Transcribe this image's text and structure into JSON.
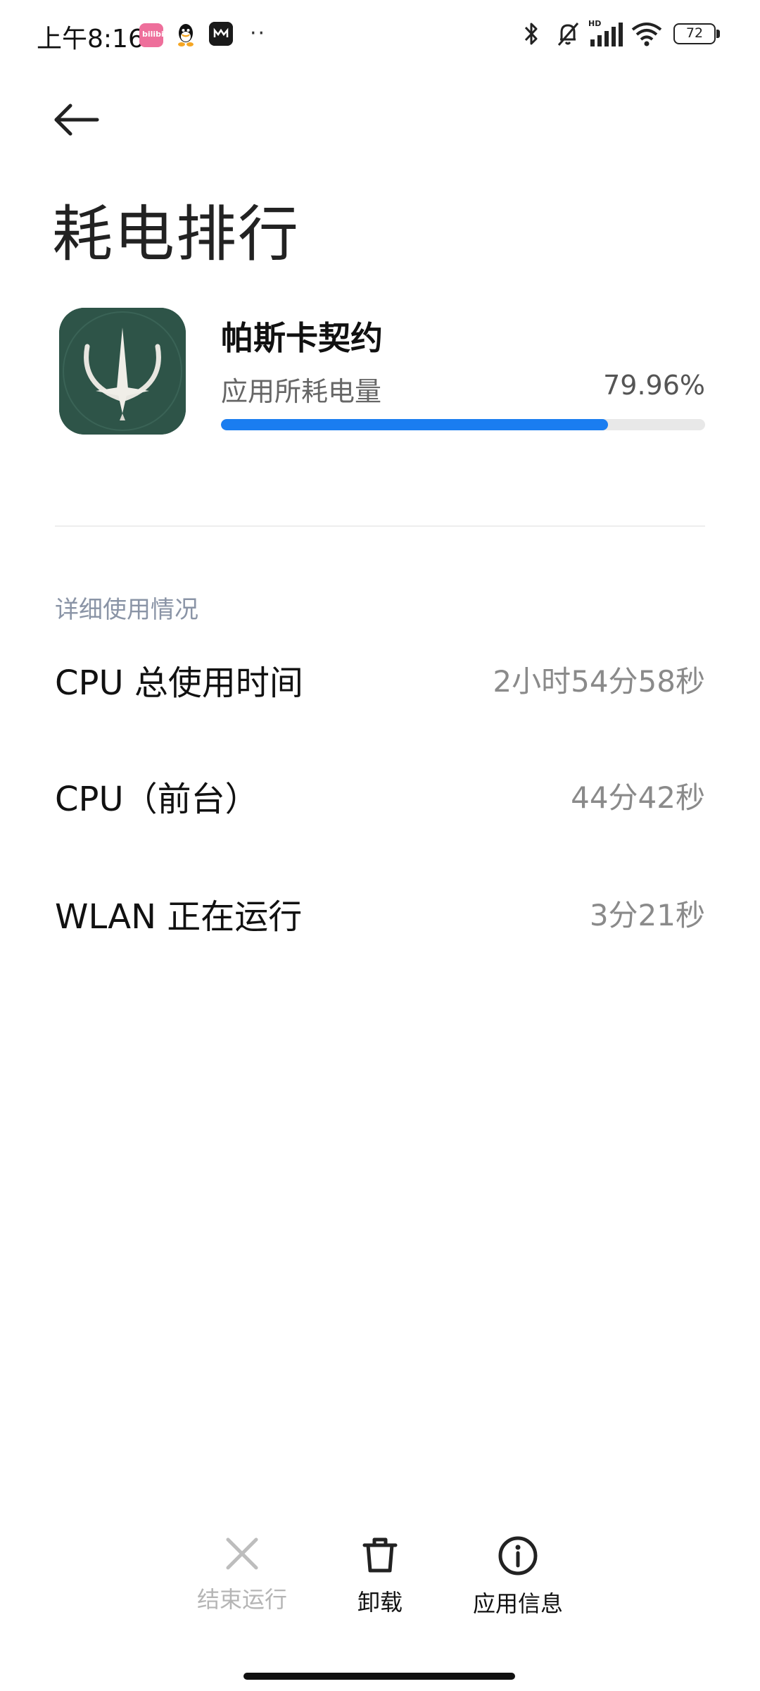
{
  "status_bar": {
    "time": "上午8:16",
    "bili_text": "bilibili",
    "battery": "72",
    "icons": [
      "bilibili-icon",
      "qq-icon",
      "music-app-icon",
      "more-dots-icon",
      "bluetooth-icon",
      "mute-icon",
      "hd-signal-icon",
      "wifi-icon",
      "battery-icon"
    ]
  },
  "header": {
    "title": "耗电排行",
    "back_icon": "arrow-left-icon"
  },
  "app": {
    "name": "帕斯卡契约",
    "usage_label": "应用所耗电量",
    "usage_value": "79.96%",
    "usage_fraction": 0.7996,
    "icon": "pascal-contract-app-icon",
    "icon_bg": "#2e5448",
    "bar_color": "#1a7df0"
  },
  "details": {
    "section_title": "详细使用情况",
    "rows": [
      {
        "label": "CPU 总使用时间",
        "value": "2小时54分58秒"
      },
      {
        "label": "CPU（前台）",
        "value": "44分42秒"
      },
      {
        "label": "WLAN 正在运行",
        "value": "3分21秒"
      }
    ]
  },
  "actions": [
    {
      "label": "结束运行",
      "icon": "close-icon",
      "enabled": false
    },
    {
      "label": "卸载",
      "icon": "trash-icon",
      "enabled": true
    },
    {
      "label": "应用信息",
      "icon": "info-icon",
      "enabled": true
    }
  ]
}
